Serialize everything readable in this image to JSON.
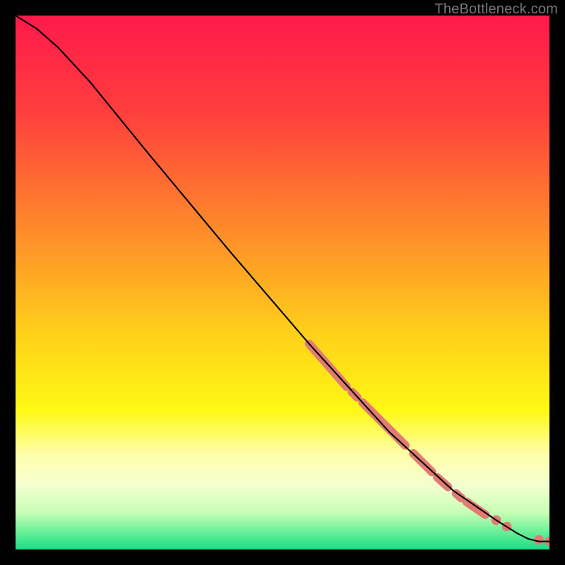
{
  "attribution": "TheBottleneck.com",
  "chart_data": {
    "type": "line",
    "title": "",
    "xlabel": "",
    "ylabel": "",
    "xlim": [
      0,
      100
    ],
    "ylim": [
      0,
      100
    ],
    "gradient_stops": [
      {
        "offset": 0.0,
        "color": "#ff1a4b"
      },
      {
        "offset": 0.18,
        "color": "#ff3e3e"
      },
      {
        "offset": 0.4,
        "color": "#ff8a2a"
      },
      {
        "offset": 0.6,
        "color": "#ffd21a"
      },
      {
        "offset": 0.74,
        "color": "#fff814"
      },
      {
        "offset": 0.82,
        "color": "#ffffa8"
      },
      {
        "offset": 0.88,
        "color": "#f4ffd2"
      },
      {
        "offset": 0.93,
        "color": "#c8ffb4"
      },
      {
        "offset": 0.965,
        "color": "#6ef09a"
      },
      {
        "offset": 1.0,
        "color": "#18dd86"
      }
    ],
    "series": [
      {
        "name": "curve",
        "points": [
          {
            "x": 0.0,
            "y": 100.0
          },
          {
            "x": 4.0,
            "y": 97.5
          },
          {
            "x": 8.0,
            "y": 94.0
          },
          {
            "x": 14.0,
            "y": 87.5
          },
          {
            "x": 25.0,
            "y": 74.0
          },
          {
            "x": 40.0,
            "y": 56.0
          },
          {
            "x": 55.0,
            "y": 38.5
          },
          {
            "x": 70.0,
            "y": 22.0
          },
          {
            "x": 82.0,
            "y": 11.0
          },
          {
            "x": 90.0,
            "y": 5.5
          },
          {
            "x": 94.0,
            "y": 3.0
          },
          {
            "x": 96.0,
            "y": 2.0
          },
          {
            "x": 98.0,
            "y": 1.5
          },
          {
            "x": 100.0,
            "y": 1.5
          }
        ]
      }
    ],
    "dot_segments": [
      {
        "x1": 55.0,
        "y1": 38.5,
        "x2": 62.0,
        "y2": 30.5
      },
      {
        "x1": 63.0,
        "y1": 29.5,
        "x2": 64.0,
        "y2": 28.5
      },
      {
        "x1": 65.0,
        "y1": 27.5,
        "x2": 73.0,
        "y2": 19.5
      },
      {
        "x1": 74.5,
        "y1": 18.0,
        "x2": 78.0,
        "y2": 14.5
      },
      {
        "x1": 79.0,
        "y1": 13.5,
        "x2": 81.0,
        "y2": 11.7
      },
      {
        "x1": 82.5,
        "y1": 10.5,
        "x2": 83.5,
        "y2": 9.6
      },
      {
        "x1": 84.5,
        "y1": 8.9,
        "x2": 88.0,
        "y2": 6.5
      }
    ],
    "dot_points": [
      {
        "x": 90.0,
        "y": 5.5
      },
      {
        "x": 92.0,
        "y": 4.3
      },
      {
        "x": 98.0,
        "y": 1.8
      },
      {
        "x": 100.0,
        "y": 1.5
      }
    ],
    "dot_color": "#e27b72",
    "curve_color": "#000000"
  }
}
